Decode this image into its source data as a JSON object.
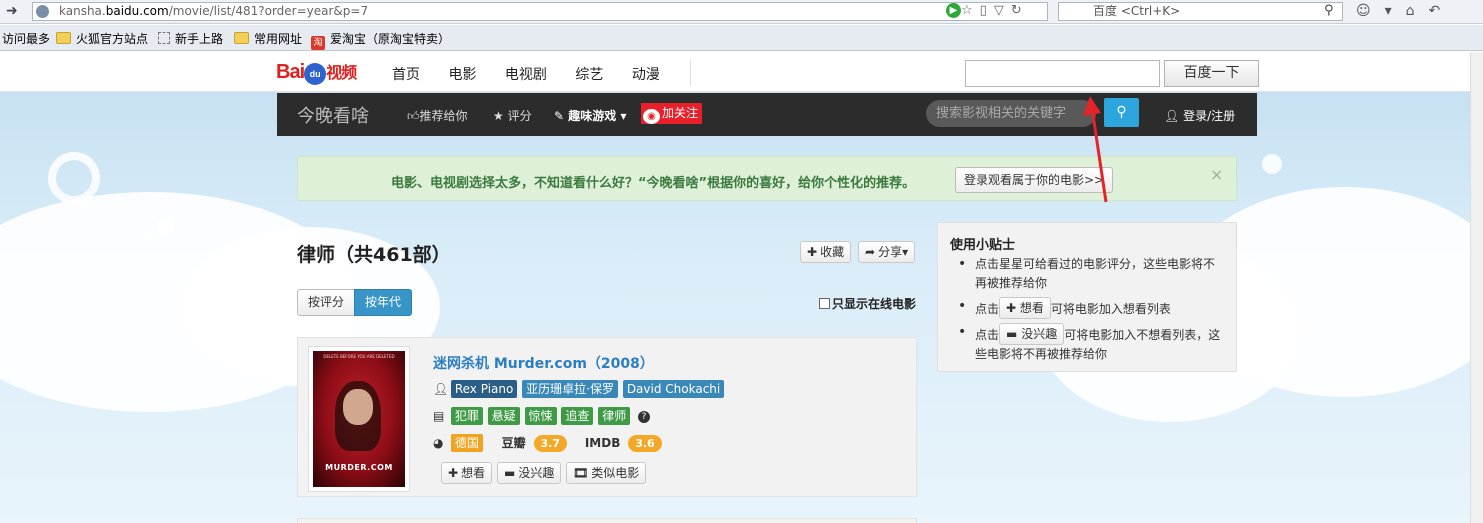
{
  "browser": {
    "url_prefix": "kansha.",
    "url_domain": "baidu.com",
    "url_path": "/movie/list/481?order=year&p=7",
    "search_engine_placeholder": "百度 <Ctrl+K>",
    "bookmarks": [
      "访问最多",
      "火狐官方站点",
      "新手上路",
      "常用网址",
      "爱淘宝（原淘宝特卖）"
    ]
  },
  "topnav": {
    "logo_bai": "Bai",
    "logo_du": "du",
    "logo_video": "视频",
    "links": [
      "首页",
      "电影",
      "电视剧",
      "综艺",
      "动漫"
    ],
    "search_button": "百度一下"
  },
  "darkbar": {
    "title": "今晚看啥",
    "recommend": "推荐给你",
    "rate": "评分",
    "games": "趣味游戏",
    "follow": "加关注",
    "search_placeholder": "搜索影视相关的关键字",
    "login": "登录/注册"
  },
  "alert": {
    "text": "电影、电视剧选择太多，不知道看什么好？“今晚看啥”根据你的喜好，给你个性化的推荐。",
    "button": "登录观看属于你的电影>>",
    "close": "×"
  },
  "list": {
    "heading": "律师（共461部）",
    "collect": "收藏",
    "share": "分享",
    "sort_by_rating": "按评分",
    "sort_by_year": "按年代",
    "online_only": "只显示在线电影"
  },
  "movie": {
    "title": "迷网杀机  Murder.com（2008）",
    "poster_title": "MURDER.COM",
    "poster_tagline": "DELETE BEFORE YOU ARE DELETED",
    "actors": [
      "Rex Piano",
      "亚历珊卓拉·保罗",
      "David Chokachi"
    ],
    "genres": [
      "犯罪",
      "悬疑",
      "惊悚",
      "追查",
      "律师"
    ],
    "region": "德国",
    "douban_label": "豆瓣",
    "douban_score": "3.7",
    "imdb_label": "IMDB",
    "imdb_score": "3.6",
    "want_button": "想看",
    "not_interested_button": "没兴趣",
    "similar_button": "类似电影"
  },
  "tips": {
    "title": "使用小贴士",
    "tip1": "点击星星可给看过的电影评分，这些电影将不再被推荐给你",
    "tip2_before": "点击",
    "tip2_button": "想看",
    "tip2_after": "可将电影加入想看列表",
    "tip3_before": "点击",
    "tip3_button": "没兴趣",
    "tip3_after": "可将电影加入不想看列表，这些电影将不再被推荐给你"
  },
  "colors": {
    "accent_blue": "#2b7fc1",
    "sort_active": "#3795c8",
    "alert_green": "#def0d8",
    "genre_green": "#3e9a45",
    "score_orange": "#f4a827",
    "weibo_red": "#e8202a",
    "annotation_arrow": "#e3242b"
  },
  "icons": [
    "back-arrow-icon",
    "globe-icon",
    "star-icon",
    "phone-icon",
    "dropdown-icon",
    "reload-icon",
    "magnifier-icon",
    "home-icon",
    "folder-icon",
    "user-icon",
    "list-icon",
    "globe-region-icon",
    "question-icon",
    "plus-icon",
    "minus-icon",
    "film-icon",
    "share-icon",
    "thumbs-up-icon",
    "weibo-icon",
    "close-icon"
  ]
}
